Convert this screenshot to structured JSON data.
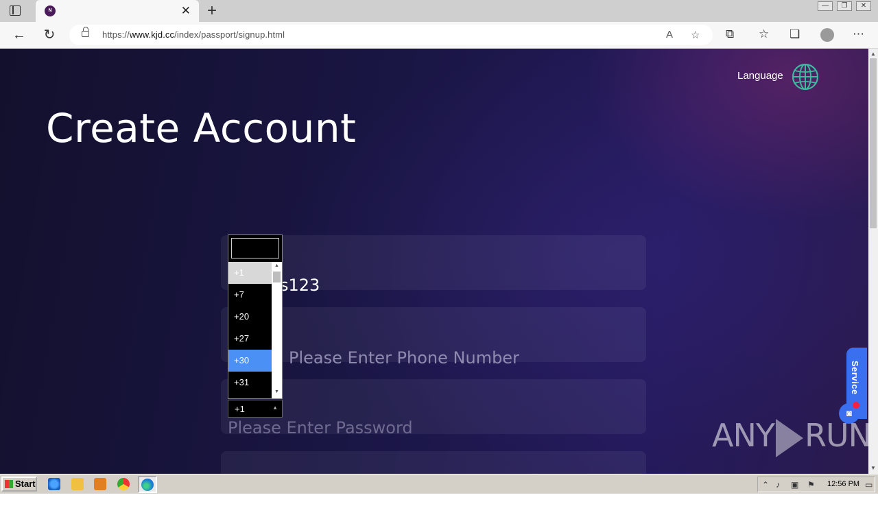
{
  "browser": {
    "tab": {
      "favicon_letter": "N",
      "close_glyph": "✕"
    },
    "new_tab_glyph": "+",
    "url": {
      "prefix": "https://",
      "host": "www.kjd.cc",
      "path": "/index/passport/signup.html"
    },
    "window_controls": [
      "—",
      "❐",
      "✕"
    ]
  },
  "page": {
    "language_label": "Language",
    "title": "Create Account",
    "username_value": "s123",
    "phone_placeholder": "Please Enter Phone Number",
    "password_hint_partial": "Please Enter Password",
    "country_code": {
      "selected": "+1",
      "options": [
        "+1",
        "+7",
        "+20",
        "+27",
        "+30",
        "+31"
      ],
      "highlighted": "+30"
    },
    "service_label": "Service"
  },
  "watermark": {
    "left": "ANY",
    "right": "RUN"
  },
  "taskbar": {
    "start_label": "Start",
    "clock": "12:56 PM"
  },
  "colors": {
    "accent": "#3a6ff0",
    "highlight": "#4a90f5",
    "globe": "#3fb8a0"
  }
}
